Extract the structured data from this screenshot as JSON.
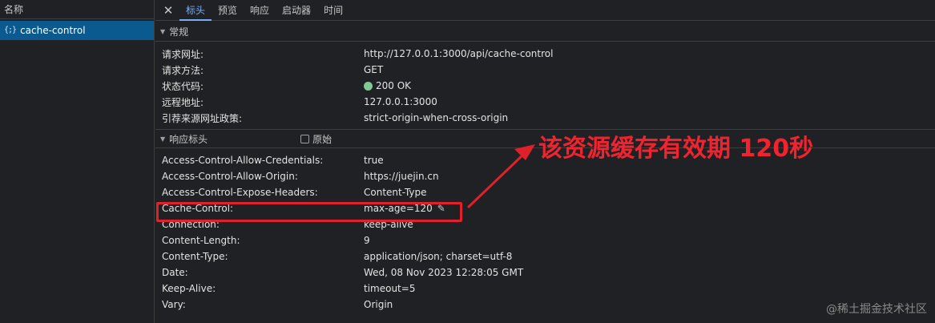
{
  "left": {
    "header": "名称",
    "request": {
      "icon": "{;}",
      "name": "cache-control"
    }
  },
  "tabs": {
    "close": "✕",
    "items": [
      "标头",
      "预览",
      "响应",
      "启动器",
      "时间"
    ],
    "active_index": 0
  },
  "general": {
    "title": "常规",
    "rows": [
      {
        "key": "请求网址:",
        "value": "http://127.0.0.1:3000/api/cache-control"
      },
      {
        "key": "请求方法:",
        "value": "GET"
      },
      {
        "key": "状态代码:",
        "value": "200 OK"
      },
      {
        "key": "远程地址:",
        "value": "127.0.0.1:3000"
      },
      {
        "key": "引荐来源网址政策:",
        "value": "strict-origin-when-cross-origin"
      }
    ]
  },
  "response_headers": {
    "title": "响应标头",
    "raw_label": "原始",
    "rows": [
      {
        "key": "Access-Control-Allow-Credentials:",
        "value": "true"
      },
      {
        "key": "Access-Control-Allow-Origin:",
        "value": "https://juejin.cn"
      },
      {
        "key": "Access-Control-Expose-Headers:",
        "value": "Content-Type"
      },
      {
        "key": "Cache-Control:",
        "value": "max-age=120"
      },
      {
        "key": "Connection:",
        "value": "keep-alive"
      },
      {
        "key": "Content-Length:",
        "value": "9"
      },
      {
        "key": "Content-Type:",
        "value": "application/json; charset=utf-8"
      },
      {
        "key": "Date:",
        "value": "Wed, 08 Nov 2023 12:28:05 GMT"
      },
      {
        "key": "Keep-Alive:",
        "value": "timeout=5"
      },
      {
        "key": "Vary:",
        "value": "Origin"
      }
    ]
  },
  "annotation": {
    "text": "该资源缓存有效期 120秒"
  },
  "watermark": "@稀土掘金技术社区",
  "colors": {
    "accent": "#7cacf8",
    "annotation": "#f0232f",
    "status_ok": "#81c995",
    "selected_row": "#0b5a8f"
  }
}
